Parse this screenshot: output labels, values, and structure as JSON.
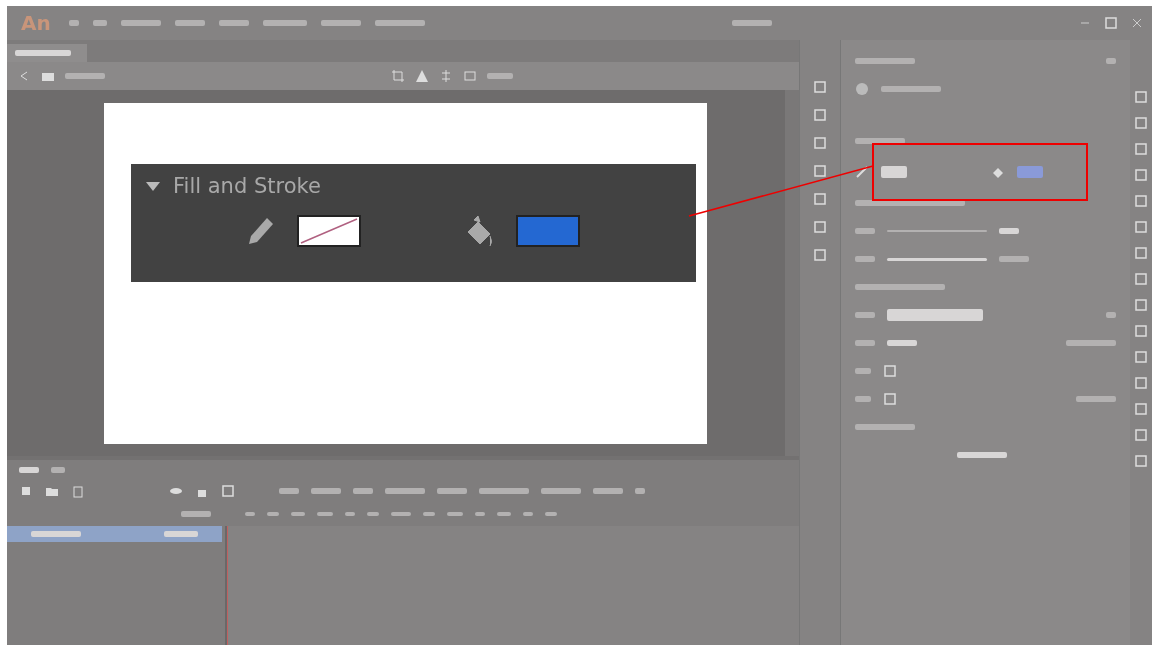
{
  "app": {
    "logo": "An"
  },
  "callout": {
    "title": "Fill and Stroke",
    "expanded": true,
    "swatches": [
      {
        "kind": "none"
      },
      {
        "kind": "solid",
        "color": "#2468d2"
      }
    ]
  }
}
